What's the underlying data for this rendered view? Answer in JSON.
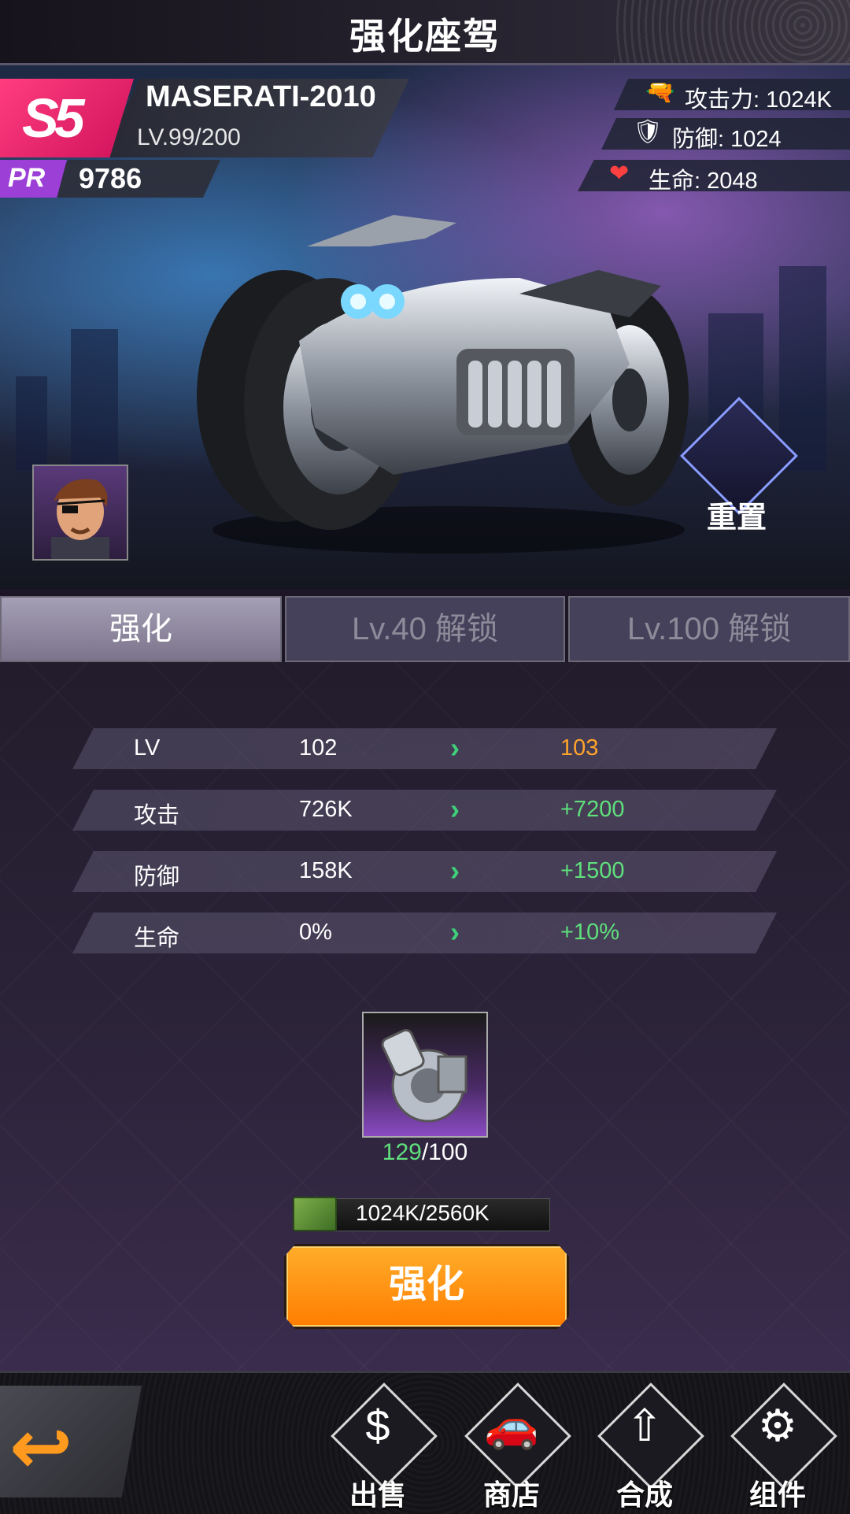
{
  "header": {
    "title": "强化座驾"
  },
  "vehicle": {
    "rank": "S5",
    "name": "MASERATI-2010",
    "level": "LV.99/200",
    "pr_label": "PR",
    "pr_value": "9786"
  },
  "stats": [
    {
      "icon": "pistol-icon",
      "text": "攻击力: 1024K"
    },
    {
      "icon": "shield-icon",
      "text": "防御: 1024"
    },
    {
      "icon": "heart-icon",
      "text": "生命: 2048"
    }
  ],
  "reset_label": "重置",
  "tabs": [
    {
      "label": "强化",
      "active": true
    },
    {
      "label": "Lv.40 解锁",
      "active": false
    },
    {
      "label": "Lv.100 解锁",
      "active": false
    }
  ],
  "upgrade_rows": [
    {
      "label": "LV",
      "current": "102",
      "next": "103"
    },
    {
      "label": "攻击",
      "current": "726K",
      "next": "+7200"
    },
    {
      "label": "防御",
      "current": "158K",
      "next": "+1500"
    },
    {
      "label": "生命",
      "current": "0%",
      "next": "+10%"
    }
  ],
  "material": {
    "have": "129",
    "need": "/100",
    "icon": "turbocharger-icon"
  },
  "cost": {
    "text": "1024K/2560K",
    "icon": "cash-icon"
  },
  "enhance_button": "强化",
  "bottom_nav": [
    {
      "label": "出售",
      "icon": "sell-icon"
    },
    {
      "label": "商店",
      "icon": "shop-icon"
    },
    {
      "label": "合成",
      "icon": "combine-icon"
    },
    {
      "label": "组件",
      "icon": "gear-icon"
    }
  ],
  "colors": {
    "accent": "#ff8a00",
    "green": "#5fe07c",
    "pink": "#e8206a",
    "purple": "#9b3fd6"
  }
}
